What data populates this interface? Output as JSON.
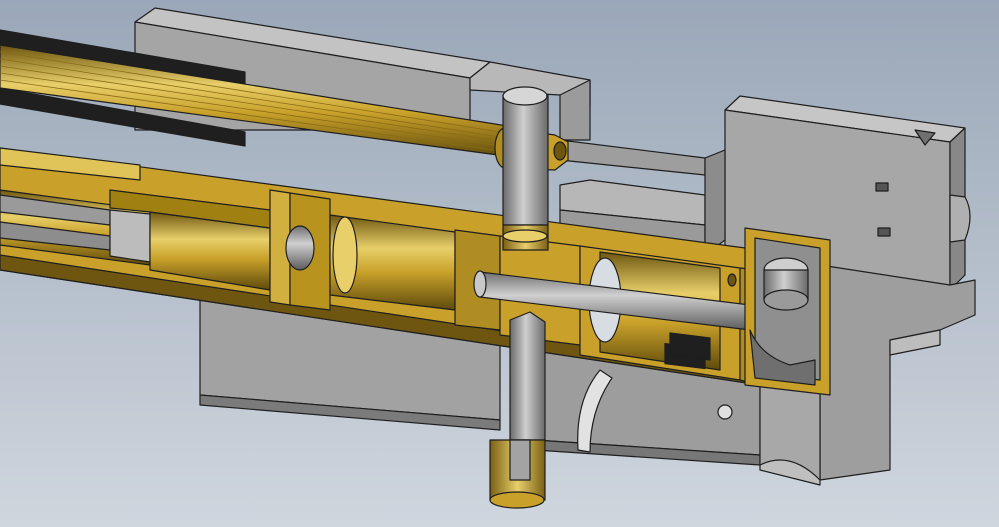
{
  "scene": {
    "subject": "",
    "colors": {
      "background_top": "#9aa7b8",
      "background_bottom": "#cfd6de",
      "steel": "#a3a3a3",
      "steel_dark": "#6f6f6f",
      "steel_light": "#c8c8c8",
      "brass": "#c9a12a",
      "brass_dark": "#6e5610",
      "brass_light": "#e8cf6a",
      "outline": "#1e1e1e"
    }
  }
}
